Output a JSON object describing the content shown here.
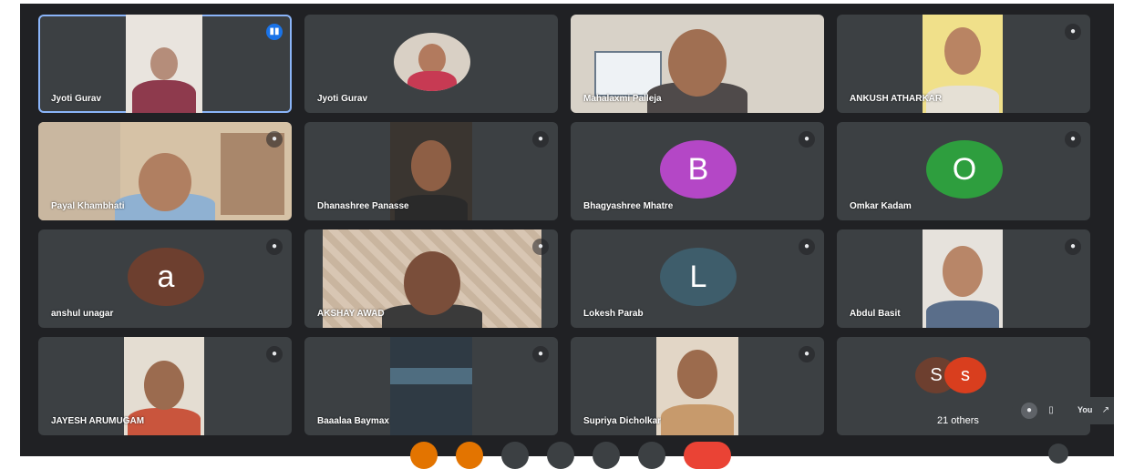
{
  "participants": [
    {
      "name": "Jyoti Gurav",
      "mic": "speaking-icon"
    },
    {
      "name": "Jyoti Gurav",
      "mic": ""
    },
    {
      "name": "Mahalaxmi Palleja",
      "mic": ""
    },
    {
      "name": "ANKUSH ATHARKAR",
      "mic": "mic-off-icon"
    },
    {
      "name": "Payal Khambhati",
      "mic": "mic-off-icon"
    },
    {
      "name": "Dhanashree Panasse",
      "mic": "mic-off-icon"
    },
    {
      "name": "Bhagyashree Mhatre",
      "mic": "mic-off-icon",
      "initial": "B",
      "color": "#b447c6"
    },
    {
      "name": "Omkar Kadam",
      "mic": "mic-off-icon",
      "initial": "O",
      "color": "#2e9e3e"
    },
    {
      "name": "anshul unagar",
      "mic": "mic-off-icon",
      "initial": "a",
      "color": "#6d3f2f"
    },
    {
      "name": "AKSHAY AWAD",
      "mic": "mic-off-icon"
    },
    {
      "name": "Lokesh Parab",
      "mic": "mic-off-icon",
      "initial": "L",
      "color": "#3e5d6b"
    },
    {
      "name": "Abdul Basit",
      "mic": "mic-off-icon"
    },
    {
      "name": "JAYESH ARUMUGAM",
      "mic": "mic-off-icon"
    },
    {
      "name": "Baaalaa Baymax",
      "mic": "mic-off-icon"
    },
    {
      "name": "Supriya Dicholkar",
      "mic": "mic-off-icon"
    }
  ],
  "others": {
    "label": "21 others",
    "initial_a": "S",
    "color_a": "#6d3f2f",
    "initial_b": "s",
    "color_b": "#d93e1e"
  },
  "self_view": {
    "label": "You"
  },
  "colors": {
    "background": "#202124",
    "tile": "#3c4043",
    "speaking_outline": "#8ab4f8",
    "hangup": "#ea4335"
  }
}
